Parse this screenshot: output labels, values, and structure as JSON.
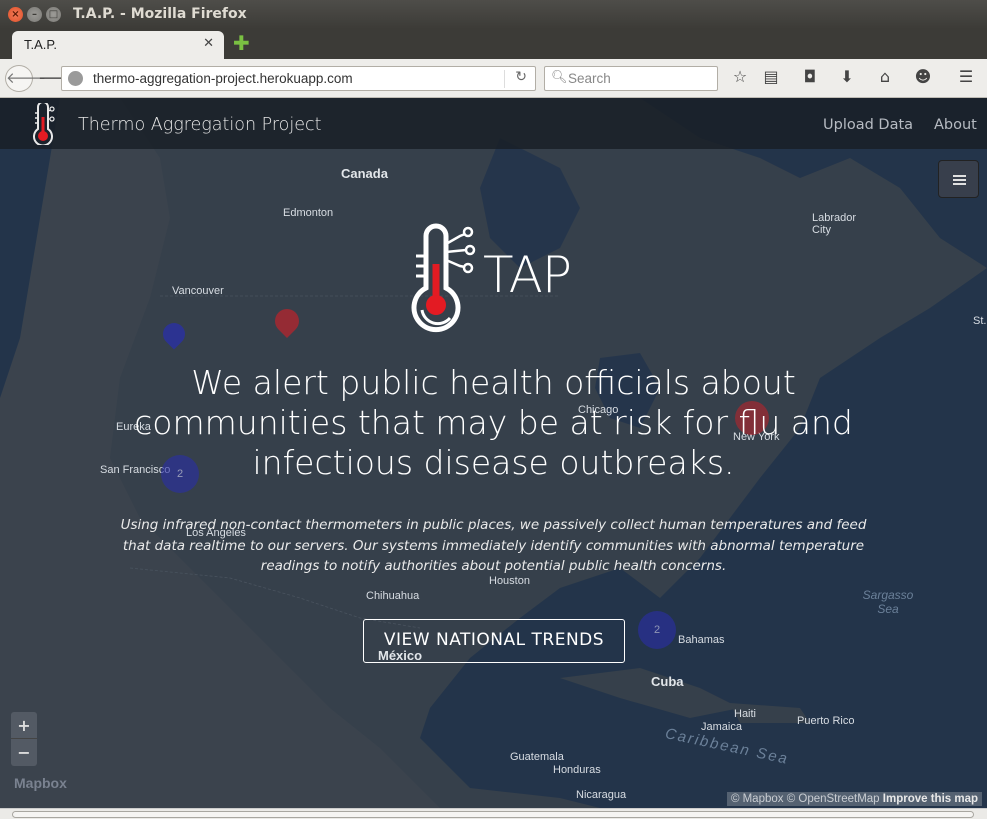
{
  "window": {
    "title": "T.A.P. - Mozilla Firefox"
  },
  "tabs": [
    {
      "label": "T.A.P."
    }
  ],
  "urlbar": {
    "value": "thermo-aggregation-project.herokuapp.com"
  },
  "search": {
    "placeholder": "Search"
  },
  "site": {
    "brand": "Thermo Aggregation Project",
    "nav": [
      {
        "label": "Upload Data"
      },
      {
        "label": "About"
      }
    ]
  },
  "hero": {
    "logo_text": "TAP",
    "headline": "We alert public health officials about communities that may be at risk for flu and infectious disease outbreaks.",
    "subtext": "Using infrared non-contact thermometers in public places, we passively collect human temperatures and feed that data realtime to our servers. Our systems immediately identify communities with abnormal temperature readings to notify authorities about potential public health concerns.",
    "cta": "VIEW NATIONAL TRENDS"
  },
  "map": {
    "zoom_in": "+",
    "zoom_out": "−",
    "provider_logo": "Mapbox",
    "attribution_prefix": "© Mapbox © OpenStreetMap",
    "attribution_link": "Improve this map",
    "labels": [
      {
        "text": "Canada",
        "kind": "big"
      },
      {
        "text": "Edmonton",
        "kind": "city"
      },
      {
        "text": "Vancouver",
        "kind": "city"
      },
      {
        "text": "Labrador City",
        "kind": "city"
      },
      {
        "text": "Eureka",
        "kind": "city"
      },
      {
        "text": "San Francisco",
        "kind": "city"
      },
      {
        "text": "Los Angeles",
        "kind": "city"
      },
      {
        "text": "Chicago",
        "kind": "city"
      },
      {
        "text": "New York",
        "kind": "city"
      },
      {
        "text": "Houston",
        "kind": "city"
      },
      {
        "text": "Chihuahua",
        "kind": "city"
      },
      {
        "text": "México",
        "kind": "big"
      },
      {
        "text": "Cuba",
        "kind": "big"
      },
      {
        "text": "Bahamas",
        "kind": "city"
      },
      {
        "text": "Haiti",
        "kind": "city"
      },
      {
        "text": "Puerto Rico",
        "kind": "city"
      },
      {
        "text": "Jamaica",
        "kind": "city"
      },
      {
        "text": "Guatemala",
        "kind": "city"
      },
      {
        "text": "Honduras",
        "kind": "city"
      },
      {
        "text": "Nicaragua",
        "kind": "city"
      },
      {
        "text": "Sargasso Sea",
        "kind": "sea"
      },
      {
        "text": "Caribbean Sea",
        "kind": "sea"
      },
      {
        "text": "St.",
        "kind": "city"
      }
    ],
    "markers": [
      {
        "color": "#2a2fa8",
        "type": "pin"
      },
      {
        "color": "#b5242c",
        "type": "pin"
      },
      {
        "color": "#2a2fa8",
        "type": "cluster",
        "count": "2"
      },
      {
        "color": "#2a2fa8",
        "type": "cluster",
        "count": "2"
      },
      {
        "color": "#b5242c",
        "type": "cluster",
        "count": ""
      }
    ]
  },
  "colors": {
    "page_bg": "#2b3b4f",
    "navbar_bg": "#191e26",
    "accent_red": "#e31b23"
  }
}
